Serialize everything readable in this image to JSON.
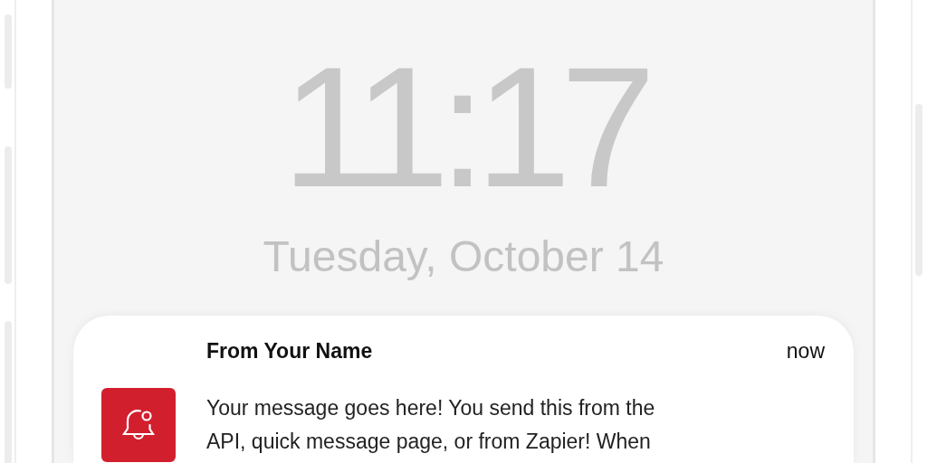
{
  "lock_screen": {
    "time": "11:17",
    "date": "Tuesday, October 14"
  },
  "notification": {
    "sender": "From Your Name",
    "time": "now",
    "message": "Your message goes here! You send this from the API, quick message page, or from Zapier! When"
  }
}
